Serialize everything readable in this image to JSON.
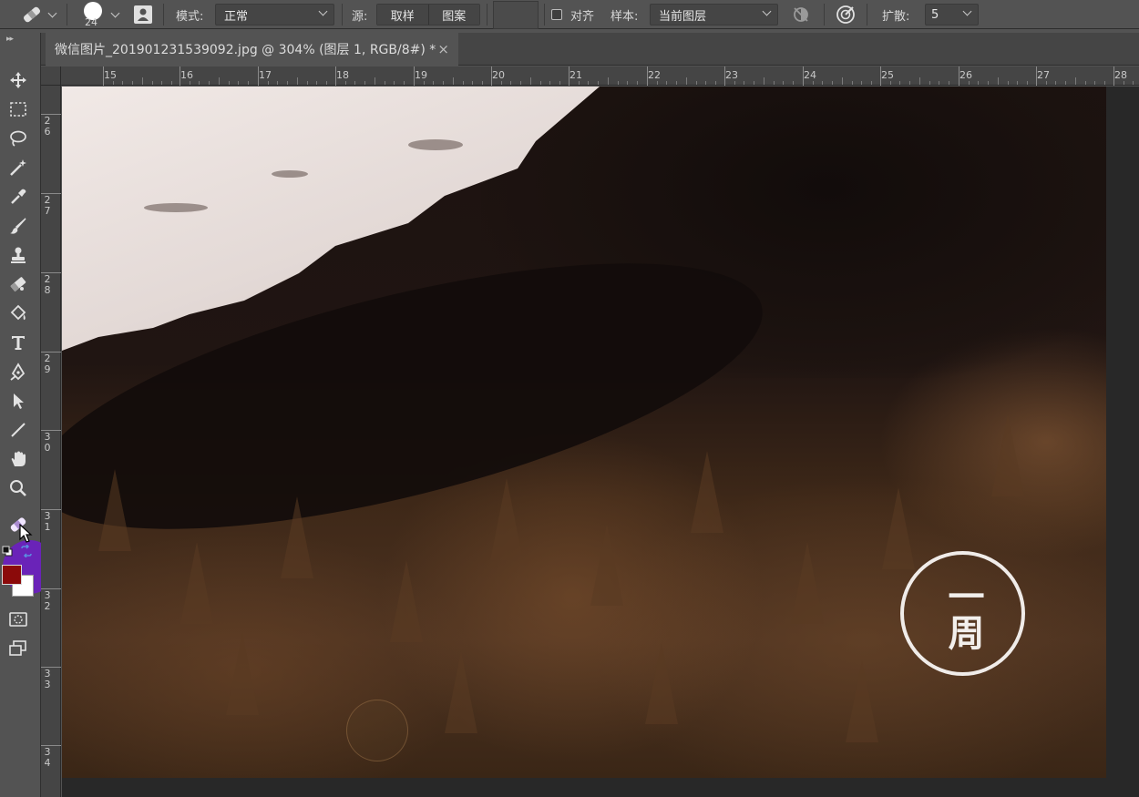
{
  "options_bar": {
    "brush_size": "24",
    "mode_label": "模式:",
    "mode_value": "正常",
    "source_label": "源:",
    "source_options": [
      "取样",
      "图案"
    ],
    "aligned_label": "对齐",
    "sample_label": "样本:",
    "sample_value": "当前图层",
    "diffusion_label": "扩散:",
    "diffusion_value": "5"
  },
  "document_tab": {
    "title": "微信图片_201901231539092.jpg @ 304% (图层 1, RGB/8#) *",
    "close_glyph": "×"
  },
  "ruler_top": [
    "15",
    "16",
    "17",
    "18",
    "19",
    "20",
    "21",
    "22",
    "23",
    "24",
    "25",
    "26",
    "27",
    "28"
  ],
  "ruler_left": [
    [
      "2",
      "6"
    ],
    [
      "2",
      "7"
    ],
    [
      "2",
      "8"
    ],
    [
      "2",
      "9"
    ],
    [
      "3",
      "0"
    ],
    [
      "3",
      "1"
    ],
    [
      "3",
      "2"
    ],
    [
      "3",
      "3"
    ],
    [
      "3",
      "4"
    ]
  ],
  "toolbar": {
    "tools": [
      "move-icon",
      "marquee-icon",
      "lasso-icon",
      "magic-wand-icon",
      "eyedropper-icon",
      "brush-icon",
      "clone-stamp-icon",
      "eraser-icon",
      "paint-bucket-icon",
      "type-icon",
      "pen-icon",
      "path-select-icon",
      "line-icon",
      "hand-icon",
      "zoom-icon",
      "healing-brush-icon"
    ],
    "foreground_color": "#8b0a0a",
    "background_color": "#ffffff",
    "active_highlight": "#6a23b8"
  },
  "canvas": {
    "stamp_text": "一周"
  }
}
